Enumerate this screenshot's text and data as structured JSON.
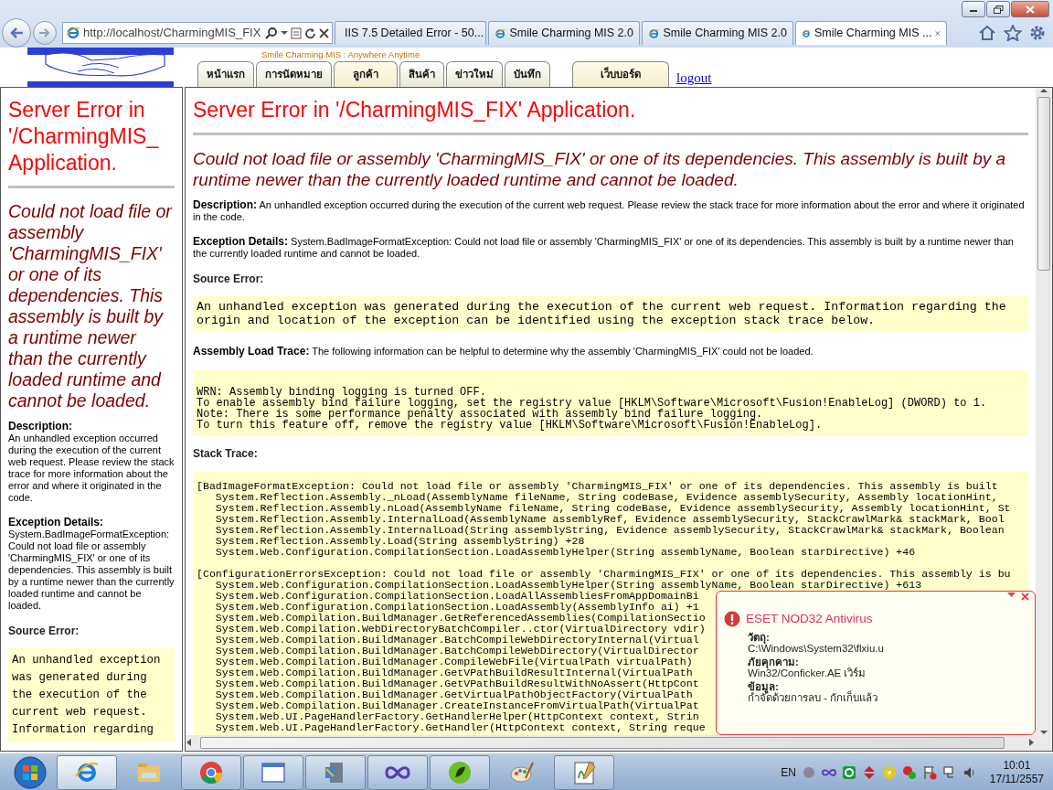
{
  "browser": {
    "address": "http://localhost/CharmingMIS_FIX",
    "tabs": [
      {
        "title": "IIS 7.5 Detailed Error - 50...",
        "selected": false
      },
      {
        "title": "Smile Charming MIS 2.0",
        "selected": false
      },
      {
        "title": "Smile Charming MIS 2.0",
        "selected": false
      },
      {
        "title": "Smile Charming MIS ...",
        "selected": true
      }
    ]
  },
  "site_header": {
    "tagline": "Smile Charming MIS : Anywhere Anytime",
    "menu": [
      {
        "label": "หน้าแรก",
        "selected": false
      },
      {
        "label": "การนัดหมาย",
        "selected": false
      },
      {
        "label": "ลูกค้า",
        "selected": true
      },
      {
        "label": "สินค้า",
        "selected": false
      },
      {
        "label": "ข่าวใหม่",
        "selected": false
      },
      {
        "label": "บันทึก",
        "selected": false
      },
      {
        "label": "เว็บบอร์ด",
        "selected": true
      }
    ],
    "logout": "logout"
  },
  "left_frame": {
    "title": "Server Error in '/CharmingMIS_ Application.",
    "message": "Could not load file or assembly 'CharmingMIS_FIX' or one of its dependencies. This assembly is built by a runtime newer than the currently loaded runtime and cannot be loaded.",
    "blocks": [
      {
        "kind": "para",
        "heading": "Description:",
        "text": "An unhandled exception occurred during the execution of the current web request. Please review the stack trace for more information about the error and where it originated in the code."
      },
      {
        "kind": "para",
        "heading": "Exception Details:",
        "text": "System.BadImageFormatException: Could not load file or assembly 'CharmingMIS_FIX' or one of its dependencies. This assembly is built by a runtime newer than the currently loaded runtime and cannot be loaded."
      },
      {
        "kind": "heading",
        "heading": "Source Error:"
      },
      {
        "kind": "code",
        "lines": [
          "An unhandled exception was generated during the execution of the current web request. Information regarding"
        ]
      }
    ]
  },
  "main_frame": {
    "title": "Server Error in '/CharmingMIS_FIX' Application.",
    "message": "Could not load file or assembly 'CharmingMIS_FIX' or one of its dependencies. This assembly is built by a runtime newer than the currently loaded runtime and cannot be loaded.",
    "blocks": [
      {
        "kind": "para",
        "heading": "Description:",
        "text": "An unhandled exception occurred during the execution of the current web request. Please review the stack trace for more information about the error and where it originated in the code."
      },
      {
        "kind": "para",
        "heading": "Exception Details:",
        "text": "System.BadImageFormatException: Could not load file or assembly 'CharmingMIS_FIX' or one of its dependencies. This assembly is built by a runtime newer than the currently loaded runtime and cannot be loaded."
      },
      {
        "kind": "heading",
        "heading": "Source Error:"
      },
      {
        "kind": "code",
        "lines": [
          "An unhandled exception was generated during the execution of the current web request. Information regarding the",
          "origin and location of the exception can be identified using the exception stack trace below."
        ]
      },
      {
        "kind": "para",
        "heading": "Assembly Load Trace:",
        "text": "The following information can be helpful to determine why the assembly 'CharmingMIS_FIX' could not be loaded."
      },
      {
        "kind": "log",
        "lines": [
          "WRN: Assembly binding logging is turned OFF.",
          "To enable assembly bind failure logging, set the registry value [HKLM\\Software\\Microsoft\\Fusion!EnableLog] (DWORD) to 1.",
          "Note: There is some performance penalty associated with assembly bind failure logging.",
          "To turn this feature off, remove the registry value [HKLM\\Software\\Microsoft\\Fusion!EnableLog]."
        ]
      },
      {
        "kind": "heading",
        "heading": "Stack Trace:"
      },
      {
        "kind": "stack",
        "groups": [
          [
            "[BadImageFormatException: Could not load file or assembly 'CharmingMIS_FIX' or one of its dependencies. This assembly is built",
            "   System.Reflection.Assembly._nLoad(AssemblyName fileName, String codeBase, Evidence assemblySecurity, Assembly locationHint,",
            "   System.Reflection.Assembly.nLoad(AssemblyName fileName, String codeBase, Evidence assemblySecurity, Assembly locationHint, St",
            "   System.Reflection.Assembly.InternalLoad(AssemblyName assemblyRef, Evidence assemblySecurity, StackCrawlMark& stackMark, Bool",
            "   System.Reflection.Assembly.InternalLoad(String assemblyString, Evidence assemblySecurity, StackCrawlMark& stackMark, Boolean",
            "   System.Reflection.Assembly.Load(String assemblyString) +28",
            "   System.Web.Configuration.CompilationSection.LoadAssemblyHelper(String assemblyName, Boolean starDirective) +46"
          ],
          [
            "[ConfigurationErrorsException: Could not load file or assembly 'CharmingMIS_FIX' or one of its dependencies. This assembly is bu",
            "   System.Web.Configuration.CompilationSection.LoadAssemblyHelper(String assemblyName, Boolean starDirective) +613",
            "   System.Web.Configuration.CompilationSection.LoadAllAssembliesFromAppDomainBi",
            "   System.Web.Configuration.CompilationSection.LoadAssembly(AssemblyInfo ai) +1",
            "   System.Web.Compilation.BuildManager.GetReferencedAssemblies(CompilationSectio",
            "   System.Web.Compilation.WebDirectoryBatchCompiler..ctor(VirtualDirectory vdir)",
            "   System.Web.Compilation.BuildManager.BatchCompileWebDirectoryInternal(Virtual",
            "   System.Web.Compilation.BuildManager.BatchCompileWebDirectory(VirtualDirector",
            "   System.Web.Compilation.BuildManager.CompileWebFile(VirtualPath virtualPath)",
            "   System.Web.Compilation.BuildManager.GetVPathBuildResultInternal(VirtualPath",
            "   System.Web.Compilation.BuildManager.GetVPathBuildResultWithNoAssert(HttpCont",
            "   System.Web.Compilation.BuildManager.GetVirtualPathObjectFactory(VirtualPath",
            "   System.Web.Compilation.BuildManager.CreateInstanceFromVirtualPath(VirtualPat",
            "   System.Web.UI.PageHandlerFactory.GetHandlerHelper(HttpContext context, Strin",
            "   System.Web.UI.PageHandlerFactory.GetHandler(HttpContext context, String reque"
          ]
        ]
      }
    ]
  },
  "notification": {
    "title": "ESET NOD32 Antivirus",
    "fields": [
      {
        "label": "วัตถุ:",
        "value": "C:\\Windows\\System32\\flxiu.u"
      },
      {
        "label": "ภัยคุกคาม:",
        "value": "Win32/Conficker.AE เวิร์ม"
      },
      {
        "label": "ข้อมูล:",
        "value": "กำจัดด้วยการลบ - กักเก็บแล้ว"
      }
    ]
  },
  "taskbar": {
    "items": [
      {
        "kind": "ie",
        "running": true,
        "selected": true
      },
      {
        "kind": "folder",
        "running": false,
        "selected": false
      },
      {
        "kind": "chrome",
        "running": true,
        "selected": false
      },
      {
        "kind": "window",
        "running": true,
        "selected": false
      },
      {
        "kind": "server",
        "running": true,
        "selected": false
      },
      {
        "kind": "infinity",
        "running": true,
        "selected": false
      },
      {
        "kind": "dw",
        "running": true,
        "selected": false
      },
      {
        "kind": "paint",
        "running": false,
        "selected": false
      },
      {
        "kind": "notepad",
        "running": true,
        "selected": false
      }
    ],
    "language": "EN",
    "time": "10:01",
    "date": "17/11/2557"
  }
}
